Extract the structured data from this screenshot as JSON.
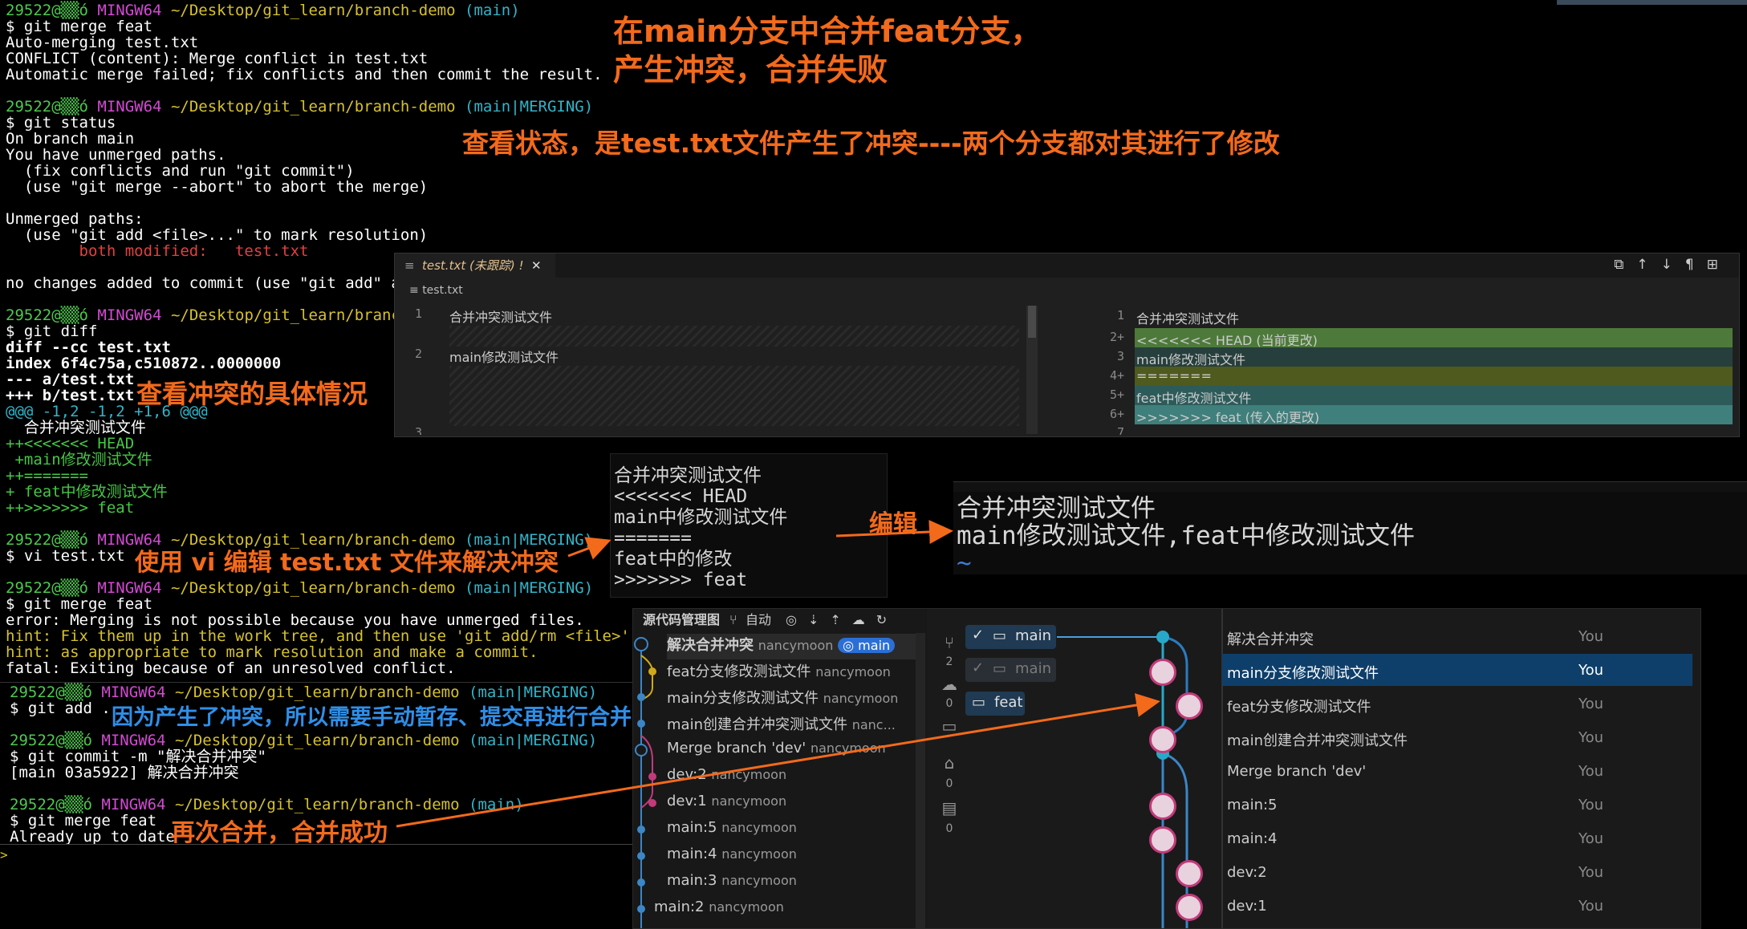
{
  "terminal": {
    "prompt_user": "29522@▒▒ó",
    "prompt_host": "MINGW64",
    "prompt_path": "~/Desktop/git_learn/branch-demo",
    "cmd_merge": "$ git merge feat",
    "merge_out": [
      "Auto-merging test.txt",
      "CONFLICT (content): Merge conflict in test.txt",
      "Automatic merge failed; fix conflicts and then commit the result."
    ],
    "branch_main": "(main)",
    "branch_merging": "(main|MERGING)",
    "cmd_status": "$ git status",
    "status_out": [
      "On branch main",
      "You have unmerged paths.",
      "  (fix conflicts and run \"git commit\")",
      "  (use \"git merge --abort\" to abort the merge)",
      "",
      "Unmerged paths:",
      "  (use \"git add <file>...\" to mark resolution)"
    ],
    "both_modified": "        both modified:   test.txt",
    "no_changes": "no changes added to commit (use \"git add\" an",
    "prompt_path_trunc": "~/Desktop/git_learn/branch",
    "cmd_diff": "$ git diff",
    "diff_head": [
      "diff --cc test.txt",
      "index 6f4c75a,c510872..0000000",
      "--- a/test.txt",
      "+++ b/test.txt"
    ],
    "diff_hunk": "@@@ -1,2 -1,2 +1,6 @@@",
    "diff_ctx": "  合并冲突测试文件",
    "diff_lines": [
      "++<<<<<<< HEAD",
      " +main修改测试文件",
      "++=======",
      "+ feat中修改测试文件",
      "++>>>>>>> feat"
    ],
    "cmd_vi": "$ vi test.txt",
    "err_lines": [
      "error: Merging is not possible because you have unmerged files."
    ],
    "hint_lines": [
      "hint: Fix them up in the work tree, and then use 'git add/rm <file>'",
      "hint: as appropriate to mark resolution and make a commit."
    ],
    "fatal": "fatal: Exiting because of an unresolved conflict.",
    "cmd_add": "$ git add .",
    "cmd_commit": "$ git commit -m \"解决合并冲突\"",
    "commit_out": "[main 03a5922] 解决合并冲突",
    "cmd_merge2": "$ git merge feat",
    "merge2_out": "Already up to date"
  },
  "annotations": {
    "a1_line1": "在main分支中合并feat分支，",
    "a1_line2": "产生冲突，合并失败",
    "a2": "查看状态，是test.txt文件产生了冲突----两个分支都对其进行了修改",
    "a3": "查看冲突的具体情况",
    "a4": "使用 vi 编辑 test.txt 文件来解决冲突",
    "a5": "编辑",
    "a6": "因为产生了冲突，所以需要手动暂存、提交再进行合并",
    "a7": "再次合并，合并成功"
  },
  "editor": {
    "tab_label": "test.txt (未跟踪) !",
    "breadcrumb": "test.txt",
    "left_lines": [
      {
        "num": "1",
        "text": "合并冲突测试文件"
      },
      {
        "num": "2",
        "text": "main修改测试文件"
      },
      {
        "num": "3",
        "text": ""
      }
    ],
    "right_lines": [
      {
        "num": "1",
        "text": "合并冲突测试文件",
        "style": "none"
      },
      {
        "num": "2+",
        "text": "<<<<<<< HEAD (当前更改)",
        "style": "green"
      },
      {
        "num": "3",
        "text": "main修改测试文件",
        "style": "teal"
      },
      {
        "num": "4+",
        "text": "=======",
        "style": "olive"
      },
      {
        "num": "5+",
        "text": "feat中修改测试文件",
        "style": "blue"
      },
      {
        "num": "6+",
        "text": ">>>>>>> feat (传入的更改)",
        "style": "blue2"
      },
      {
        "num": "7",
        "text": "",
        "style": "none"
      }
    ]
  },
  "vi_before": [
    "合并冲突测试文件",
    "<<<<<<< HEAD",
    "main中修改测试文件",
    "=======",
    "feat中的修改",
    ">>>>>>> feat"
  ],
  "vi_after": [
    "合并冲突测试文件",
    "main修改测试文件,feat中修改测试文件",
    "~"
  ],
  "scm": {
    "header_title": "源代码管理图",
    "header_auto": "自动",
    "rows": [
      {
        "msg": "解决合并冲突",
        "author": "nancymoon",
        "badge": "main",
        "bold": true
      },
      {
        "msg": "feat分支修改测试文件",
        "author": "nancymoon"
      },
      {
        "msg": "main分支修改测试文件",
        "author": "nancymoon"
      },
      {
        "msg": "main创建合并冲突测试文件",
        "author": "nanc..."
      },
      {
        "msg": "Merge branch 'dev'",
        "author": "nancymoon"
      },
      {
        "msg": "dev:2",
        "author": "nancymoon"
      },
      {
        "msg": "dev:1",
        "author": "nancymoon"
      },
      {
        "msg": "main:5",
        "author": "nancymoon"
      },
      {
        "msg": "main:4",
        "author": "nancymoon"
      },
      {
        "msg": "main:3",
        "author": "nancymoon"
      },
      {
        "msg": "main:2",
        "author": "nancymoon"
      }
    ],
    "activity_counts": [
      "2",
      "0",
      "0",
      "0"
    ],
    "branch_pills": [
      {
        "label": "main",
        "checked": true
      },
      {
        "label": "main",
        "checked": true
      },
      {
        "label": "feat",
        "checked": false
      }
    ],
    "graph_rows": [
      {
        "msg": "解决合并冲突",
        "author": "You"
      },
      {
        "msg": "main分支修改测试文件",
        "author": "You",
        "selected": true
      },
      {
        "msg": "feat分支修改测试文件",
        "author": "You"
      },
      {
        "msg": "main创建合并冲突测试文件",
        "author": "You"
      },
      {
        "msg": "Merge branch 'dev'",
        "author": "You"
      },
      {
        "msg": "main:5",
        "author": "You"
      },
      {
        "msg": "main:4",
        "author": "You"
      },
      {
        "msg": "dev:2",
        "author": "You"
      },
      {
        "msg": "dev:1",
        "author": "You"
      }
    ]
  }
}
